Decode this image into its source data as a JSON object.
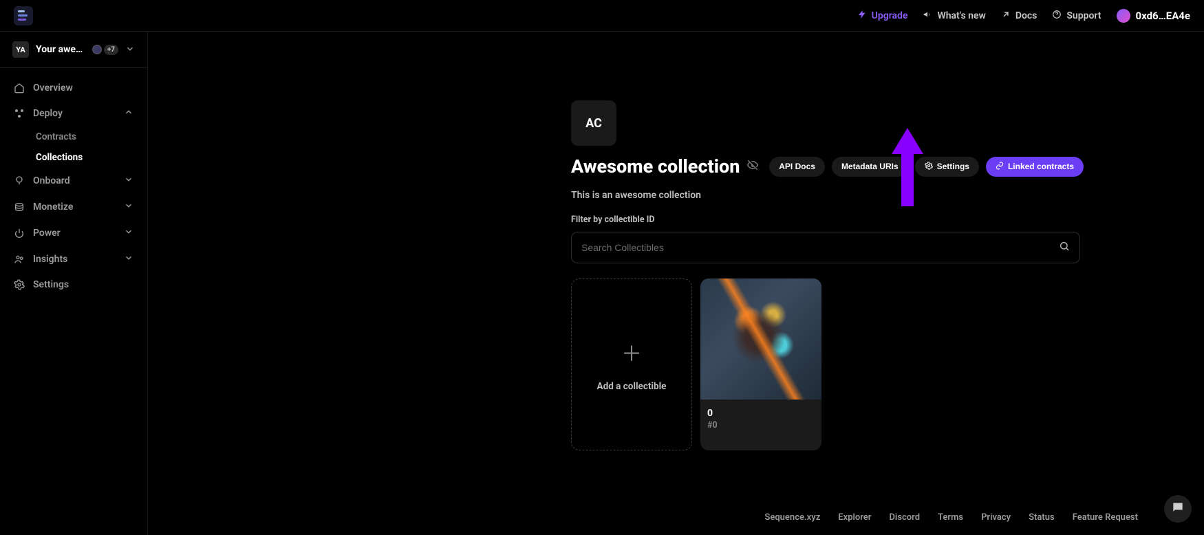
{
  "topbar": {
    "upgrade": "Upgrade",
    "whats_new": "What's new",
    "docs": "Docs",
    "support": "Support",
    "wallet": "0xd6…EA4e"
  },
  "project": {
    "avatar": "YA",
    "name": "Your aweso…",
    "plus_badge": "+7"
  },
  "sidebar": {
    "overview": "Overview",
    "deploy": "Deploy",
    "deploy_contracts": "Contracts",
    "deploy_collections": "Collections",
    "onboard": "Onboard",
    "monetize": "Monetize",
    "power": "Power",
    "insights": "Insights",
    "settings": "Settings"
  },
  "collection": {
    "avatar": "AC",
    "title": "Awesome collection",
    "description": "This is an awesome collection",
    "filter_label": "Filter by collectible ID",
    "search_placeholder": "Search Collectibles",
    "actions": {
      "api_docs": "API Docs",
      "metadata_uris": "Metadata URIs",
      "settings": "Settings",
      "linked_contracts": "Linked contracts"
    },
    "add_card_label": "Add a collectible",
    "items": [
      {
        "id": "0",
        "sub": "#0"
      }
    ]
  },
  "footer": {
    "links": [
      "Sequence.xyz",
      "Explorer",
      "Discord",
      "Terms",
      "Privacy",
      "Status",
      "Feature Request"
    ]
  }
}
